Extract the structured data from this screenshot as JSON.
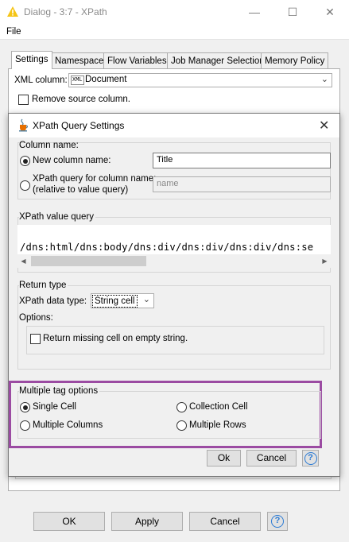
{
  "window": {
    "title": "Dialog - 3:7 - XPath",
    "menu_file": "File",
    "minimize": "—",
    "maximize": "☐",
    "close": "✕"
  },
  "tabs": [
    "Settings",
    "Namespace",
    "Flow Variables",
    "Job Manager Selection",
    "Memory Policy"
  ],
  "settings": {
    "xml_column_label": "XML column:",
    "xml_badge": "XML",
    "xml_column_value": "Document",
    "remove_source_label": "Remove source column."
  },
  "bottom_buttons": {
    "ok": "OK",
    "apply": "Apply",
    "cancel": "Cancel",
    "help": "?"
  },
  "dialog": {
    "title": "XPath Query Settings",
    "close": "✕",
    "column_name_group": "Column name:",
    "new_column_label": "New column name:",
    "new_column_value": "Title",
    "xpath_query_label_1": "XPath query for column name:",
    "xpath_query_label_2": "(relative to value query)",
    "xpath_query_placeholder": "name",
    "xpath_value_group": "XPath value query",
    "xpath_value": "/dns:html/dns:body/dns:div/dns:div/dns:div/dns:se",
    "return_type_group": "Return type",
    "data_type_label": "XPath data type:",
    "data_type_value": "String cell",
    "options_label": "Options:",
    "return_missing_label": "Return missing cell on empty string.",
    "multiple_tag_group": "Multiple tag options",
    "single_cell": "Single Cell",
    "collection_cell": "Collection Cell",
    "multiple_columns": "Multiple Columns",
    "multiple_rows": "Multiple Rows",
    "ok": "Ok",
    "cancel": "Cancel",
    "help": "?"
  },
  "colors": {
    "highlight": "#9b4ba2",
    "help_icon": "#2a7ad4"
  }
}
